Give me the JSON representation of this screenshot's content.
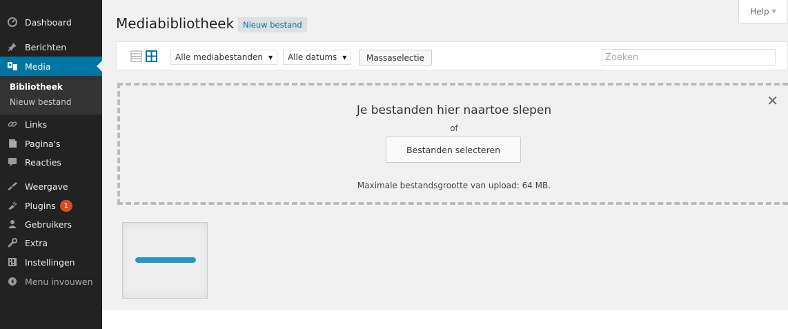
{
  "sidebar": {
    "items": [
      {
        "label": "Dashboard",
        "icon": "dashboard-icon"
      },
      {
        "label": "Berichten",
        "icon": "pin-icon"
      },
      {
        "label": "Media",
        "icon": "media-icon"
      },
      {
        "label": "Links",
        "icon": "link-icon"
      },
      {
        "label": "Pagina's",
        "icon": "pages-icon"
      },
      {
        "label": "Reacties",
        "icon": "comment-icon"
      },
      {
        "label": "Weergave",
        "icon": "brush-icon"
      },
      {
        "label": "Plugins",
        "icon": "plugin-icon",
        "badge": "1"
      },
      {
        "label": "Gebruikers",
        "icon": "users-icon"
      },
      {
        "label": "Extra",
        "icon": "wrench-icon"
      },
      {
        "label": "Instellingen",
        "icon": "settings-icon"
      },
      {
        "label": "Menu invouwen",
        "icon": "collapse-icon"
      }
    ],
    "submenu": [
      "Bibliotheek",
      "Nieuw bestand"
    ],
    "active_color": "#0074a2",
    "badge_color": "#d54e21"
  },
  "header": {
    "help_label": "Help",
    "title": "Mediabibliotheek",
    "add_new_label": "Nieuw bestand"
  },
  "toolbar": {
    "filter_type": "Alle mediabestanden",
    "filter_date": "Alle datums",
    "bulk_select_label": "Massaselectie",
    "search_placeholder": "Zoeken"
  },
  "dropzone": {
    "title": "Je bestanden hier naartoe slepen",
    "or_label": "of",
    "select_button": "Bestanden selecteren",
    "max_upload": "Maximale bestandsgrootte van upload: 64 MB."
  },
  "attachment": {
    "upload_progress_percent": 100,
    "progress_color": "#2a95c5"
  }
}
